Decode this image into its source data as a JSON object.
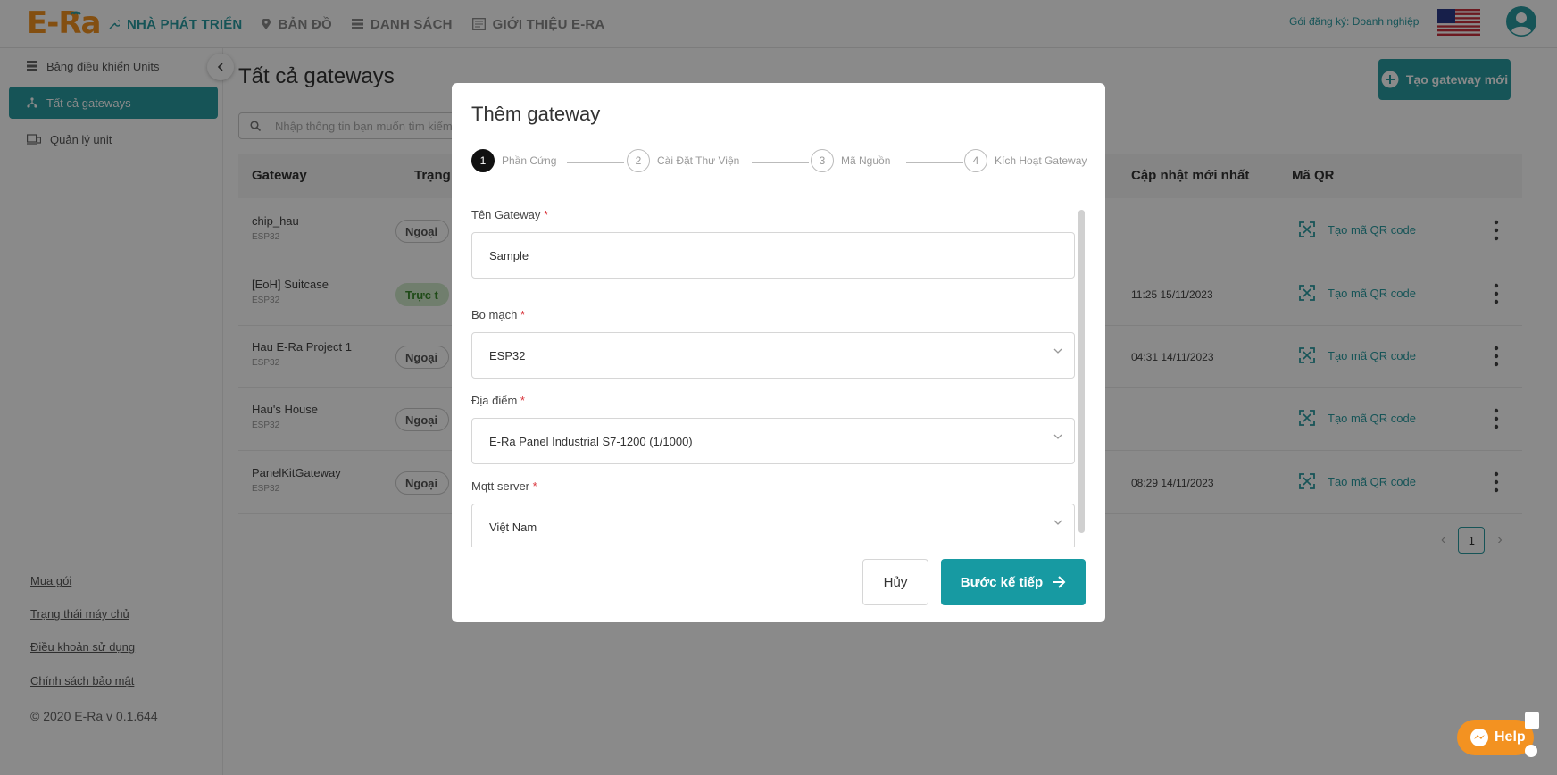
{
  "brand": {
    "logo_text": "E-Ra",
    "accent": "#2a9ca2",
    "logo_color": "#f39221"
  },
  "nav": [
    {
      "label": "NHÀ PHÁT TRIỂN",
      "icon": "wrench-icon",
      "active": true
    },
    {
      "label": "BẢN ĐỒ",
      "icon": "map-pin-icon"
    },
    {
      "label": "DANH SÁCH",
      "icon": "list-icon"
    },
    {
      "label": "GIỚI THIỆU E-RA",
      "icon": "info-card-icon"
    }
  ],
  "header": {
    "plan": "Gói đăng ký: Doanh nghiệp",
    "language_flag": "us-flag-icon",
    "avatar": "user-avatar-icon"
  },
  "sidebar": {
    "items": [
      {
        "label": "Bảng điều khiển Units",
        "icon": "dashboard-icon"
      },
      {
        "label": "Tất cả gateways",
        "icon": "network-icon",
        "active": true
      },
      {
        "label": "Quản lý unit",
        "icon": "device-icon"
      }
    ],
    "links": [
      "Mua gói",
      "Trạng thái máy chủ",
      "Điều khoản sử dụng",
      "Chính sách bảo mật"
    ],
    "copyright": "© 2020 E-Ra v 0.1.644"
  },
  "main": {
    "title": "Tất cả gateways",
    "new_button": "Tạo gateway mới",
    "search_placeholder": "Nhập thông tin bạn muốn tìm kiếm",
    "columns": [
      "Gateway",
      "Trạng",
      "Cập nhật mới nhất",
      "Mã QR"
    ],
    "rows": [
      {
        "name": "chip_hau",
        "type": "ESP32",
        "status": "Ngoại",
        "updated": "",
        "qr": "Tạo mã QR code"
      },
      {
        "name": "[EoH] Suitcase",
        "type": "ESP32",
        "status": "Trực t",
        "online": true,
        "updated": "11:25 15/11/2023",
        "qr": "Tạo mã QR code"
      },
      {
        "name": "Hau E-Ra Project 1",
        "type": "ESP32",
        "status": "Ngoại",
        "updated": "04:31 14/11/2023",
        "qr": "Tạo mã QR code"
      },
      {
        "name": "Hau's House",
        "type": "ESP32",
        "status": "Ngoại",
        "updated": "",
        "qr": "Tạo mã QR code"
      },
      {
        "name": "PanelKitGateway",
        "type": "ESP32",
        "status": "Ngoại",
        "updated": "08:29 14/11/2023",
        "qr": "Tạo mã QR code"
      }
    ],
    "page": "1"
  },
  "modal": {
    "title": "Thêm gateway",
    "steps": [
      {
        "num": "1",
        "label": "Phần Cứng",
        "active": true
      },
      {
        "num": "2",
        "label": "Cài Đặt Thư Viện"
      },
      {
        "num": "3",
        "label": "Mã Nguồn"
      },
      {
        "num": "4",
        "label": "Kích Hoạt Gateway"
      }
    ],
    "fields": [
      {
        "label": "Tên Gateway",
        "value": "Sample"
      },
      {
        "label": "Bo mạch",
        "value": "ESP32"
      },
      {
        "label": "Địa điểm",
        "value": "E-Ra Panel Industrial S7-1200 (1/1000)"
      },
      {
        "label": "Mqtt server",
        "value": "Việt Nam"
      }
    ],
    "required_mark": "*",
    "cancel": "Hủy",
    "next": "Bước kế tiếp"
  },
  "help": {
    "label": "Help"
  }
}
